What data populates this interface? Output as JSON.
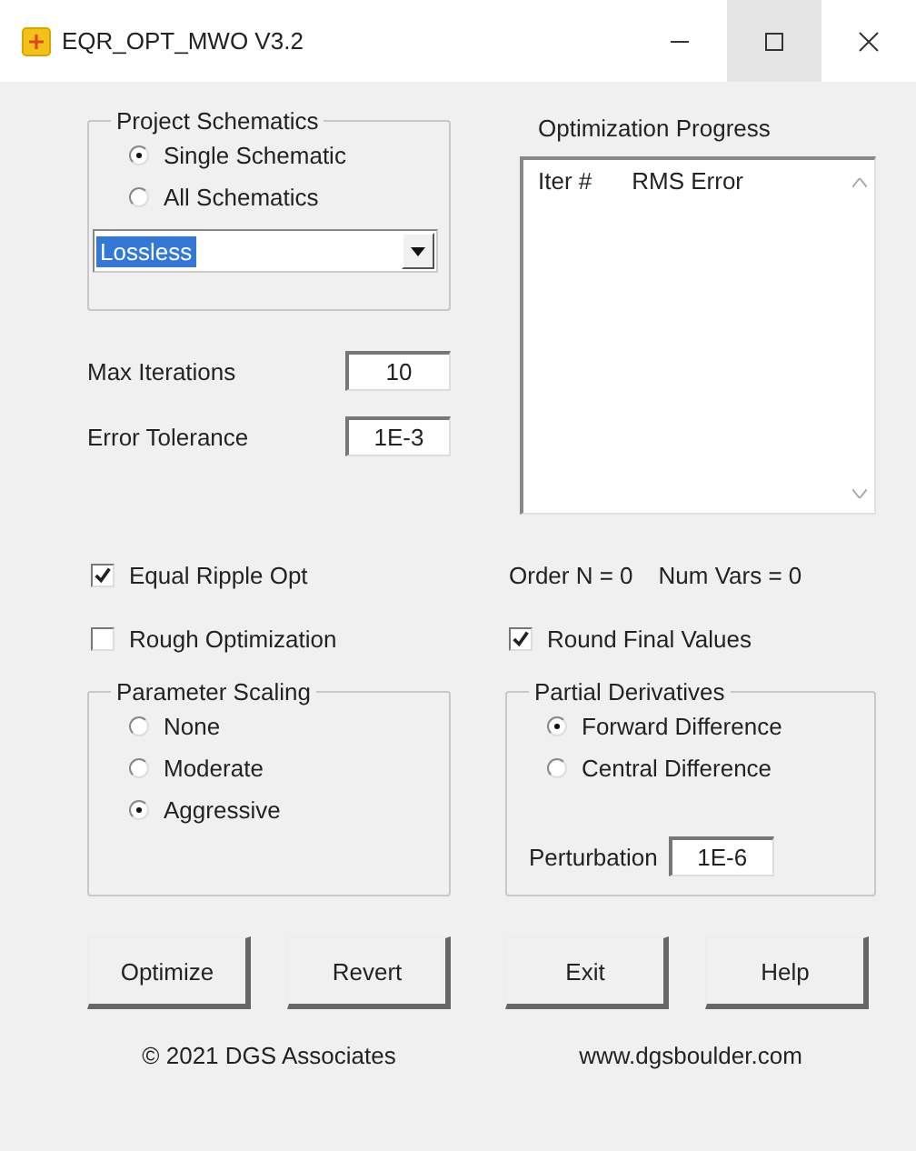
{
  "window": {
    "title": "EQR_OPT_MWO  V3.2"
  },
  "project_schematics": {
    "label": "Project Schematics",
    "options": [
      {
        "label": "Single Schematic",
        "selected": true
      },
      {
        "label": "All Schematics",
        "selected": false
      }
    ],
    "dropdown": {
      "value": "Lossless",
      "highlighted": true
    }
  },
  "fields": [
    {
      "label": "Max Iterations",
      "value": "10"
    },
    {
      "label": "Error Tolerance",
      "value": "1E-3"
    }
  ],
  "progress": {
    "label": "Optimization Progress",
    "columns": [
      "Iter #",
      "RMS Error"
    ]
  },
  "equal_ripple": {
    "label": "Equal Ripple Opt",
    "checked": true
  },
  "status": [
    "Order N = 0",
    "Num Vars = 0"
  ],
  "rough_optimization": {
    "label": "Rough Optimization",
    "checked": false
  },
  "round_final_values": {
    "label": "Round Final Values",
    "checked": true
  },
  "parameter_scaling": {
    "label": "Parameter Scaling",
    "options": [
      {
        "label": "None",
        "selected": false
      },
      {
        "label": "Moderate",
        "selected": false
      },
      {
        "label": "Aggressive",
        "selected": true
      }
    ]
  },
  "partial_derivatives": {
    "label": "Partial Derivatives",
    "options": [
      {
        "label": "Forward Difference",
        "selected": true
      },
      {
        "label": "Central Difference",
        "selected": false
      }
    ],
    "perturbation": {
      "label": "Perturbation",
      "value": "1E-6"
    }
  },
  "buttons": [
    "Optimize",
    "Revert",
    "Exit",
    "Help"
  ],
  "footer": {
    "copyright": "© 2021 DGS Associates",
    "website": "www.dgsboulder.com"
  }
}
